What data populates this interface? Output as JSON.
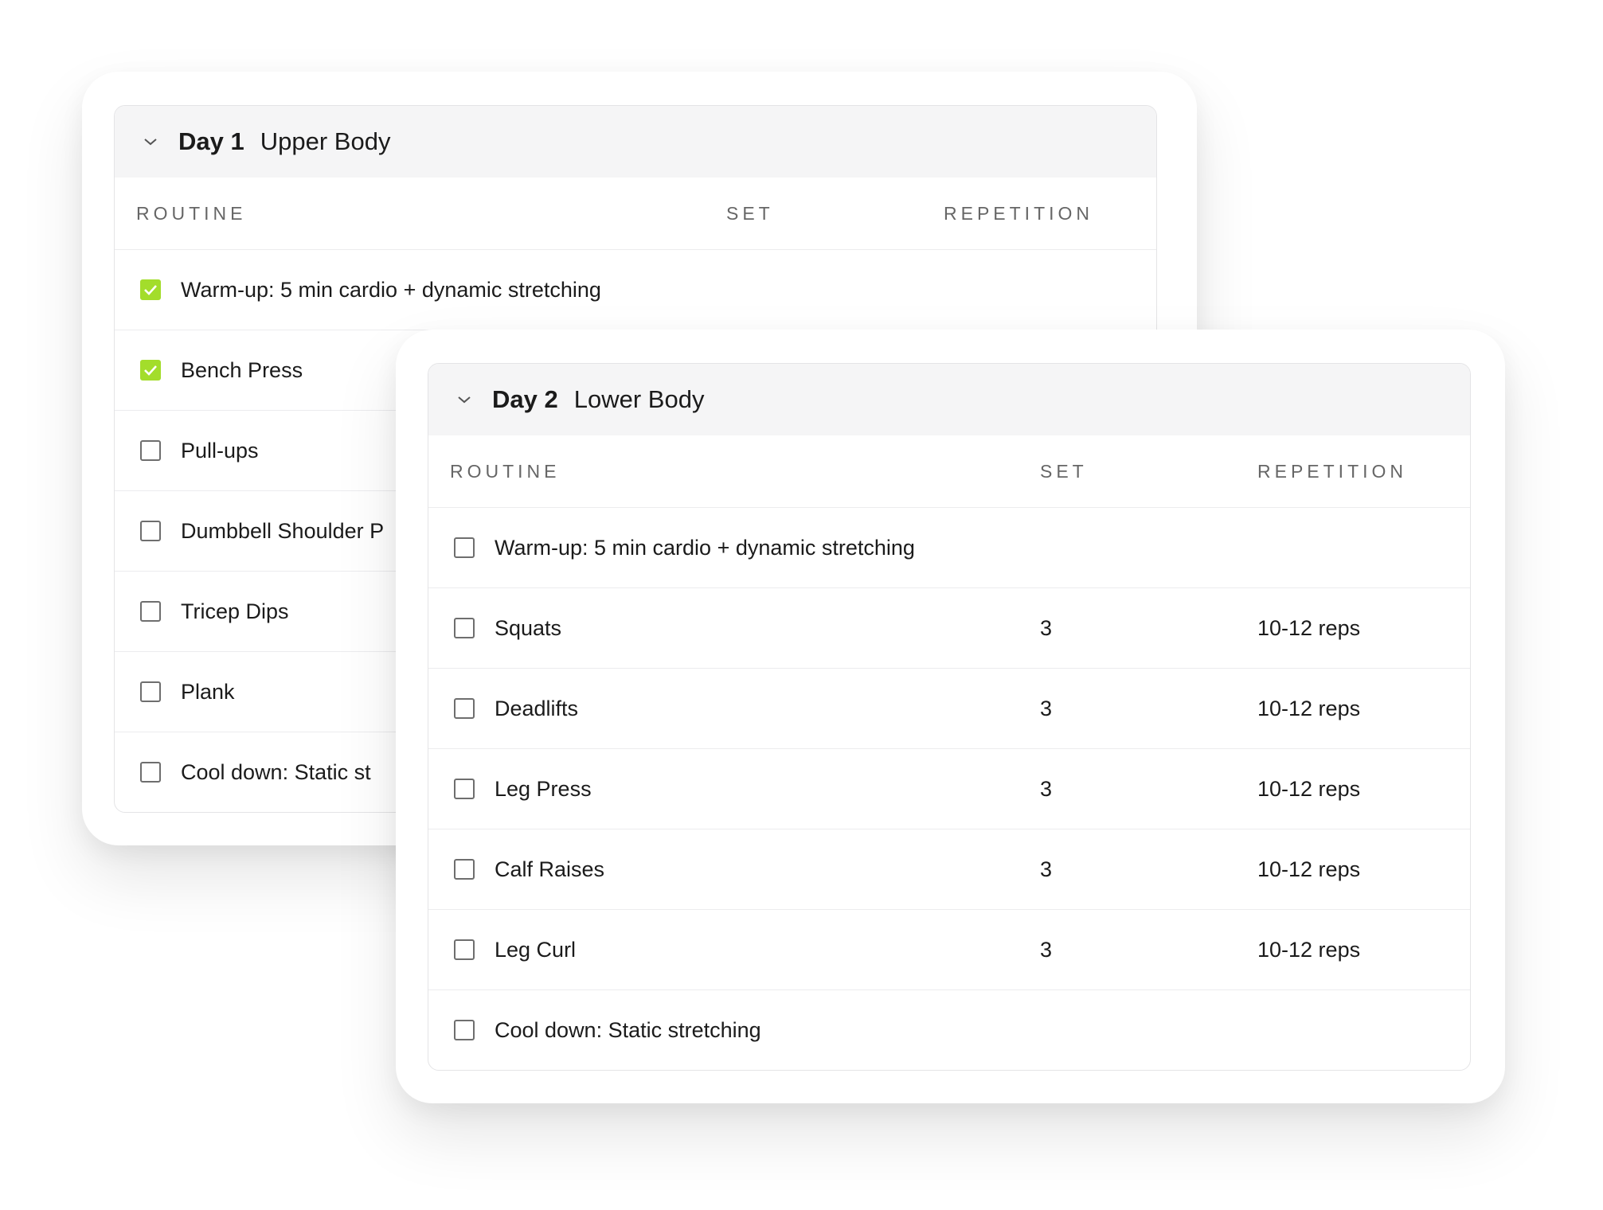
{
  "columns": {
    "routine": "ROUTINE",
    "set": "SET",
    "repetition": "REPETITION"
  },
  "accent_color": "#a3dd2b",
  "days": [
    {
      "day": "Day 1",
      "title": "Upper Body",
      "expanded": true,
      "rows": [
        {
          "name": "Warm-up: 5 min cardio + dynamic stretching",
          "set": "",
          "rep": "",
          "checked": true
        },
        {
          "name": "Bench Press",
          "set": "",
          "rep": "",
          "checked": true
        },
        {
          "name": "Pull-ups",
          "set": "",
          "rep": "",
          "checked": false
        },
        {
          "name": "Dumbbell Shoulder P",
          "set": "",
          "rep": "",
          "checked": false
        },
        {
          "name": "Tricep Dips",
          "set": "",
          "rep": "",
          "checked": false
        },
        {
          "name": "Plank",
          "set": "",
          "rep": "",
          "checked": false
        },
        {
          "name": "Cool down: Static st",
          "set": "",
          "rep": "",
          "checked": false
        }
      ]
    },
    {
      "day": "Day 2",
      "title": "Lower Body",
      "expanded": true,
      "rows": [
        {
          "name": "Warm-up: 5 min cardio + dynamic stretching",
          "set": "",
          "rep": "",
          "checked": false
        },
        {
          "name": "Squats",
          "set": "3",
          "rep": "10-12 reps",
          "checked": false
        },
        {
          "name": "Deadlifts",
          "set": "3",
          "rep": "10-12 reps",
          "checked": false
        },
        {
          "name": "Leg Press",
          "set": "3",
          "rep": "10-12 reps",
          "checked": false
        },
        {
          "name": "Calf Raises",
          "set": "3",
          "rep": "10-12 reps",
          "checked": false
        },
        {
          "name": "Leg Curl",
          "set": "3",
          "rep": "10-12 reps",
          "checked": false
        },
        {
          "name": "Cool down: Static stretching",
          "set": "",
          "rep": "",
          "checked": false
        }
      ]
    }
  ]
}
